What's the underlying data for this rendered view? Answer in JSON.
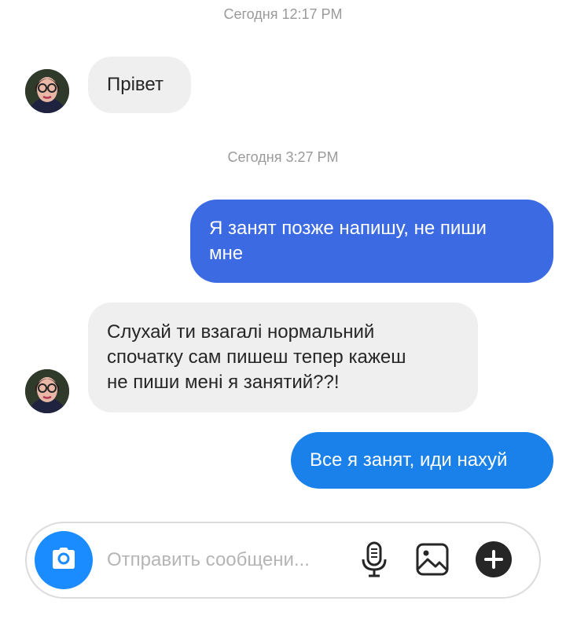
{
  "colors": {
    "outgoing_blue_dark": "#3b6ae3",
    "outgoing_blue_light": "#1a80ea",
    "incoming_gray": "#efefef",
    "camera_blue": "#1a8cff",
    "timestamp_gray": "#9a9a9a"
  },
  "timestamps": [
    "Сегодня 12:17 PM",
    "Сегодня 3:27 PM"
  ],
  "messages": [
    {
      "direction": "incoming",
      "text": "Прівет"
    },
    {
      "direction": "outgoing",
      "lines": [
        "Я занят позже напишу, не пиши",
        "мне"
      ]
    },
    {
      "direction": "incoming",
      "lines": [
        "Слухай ти взагалі нормальний",
        "спочатку сам пишеш тепер кажеш",
        "не пиши мені я занятий??!"
      ]
    },
    {
      "direction": "outgoing",
      "text": "Все я занят, иди нахуй"
    }
  ],
  "composer": {
    "placeholder": "Отправить сообщени...",
    "icons": [
      "camera-icon",
      "microphone-icon",
      "image-icon",
      "plus-icon"
    ]
  }
}
